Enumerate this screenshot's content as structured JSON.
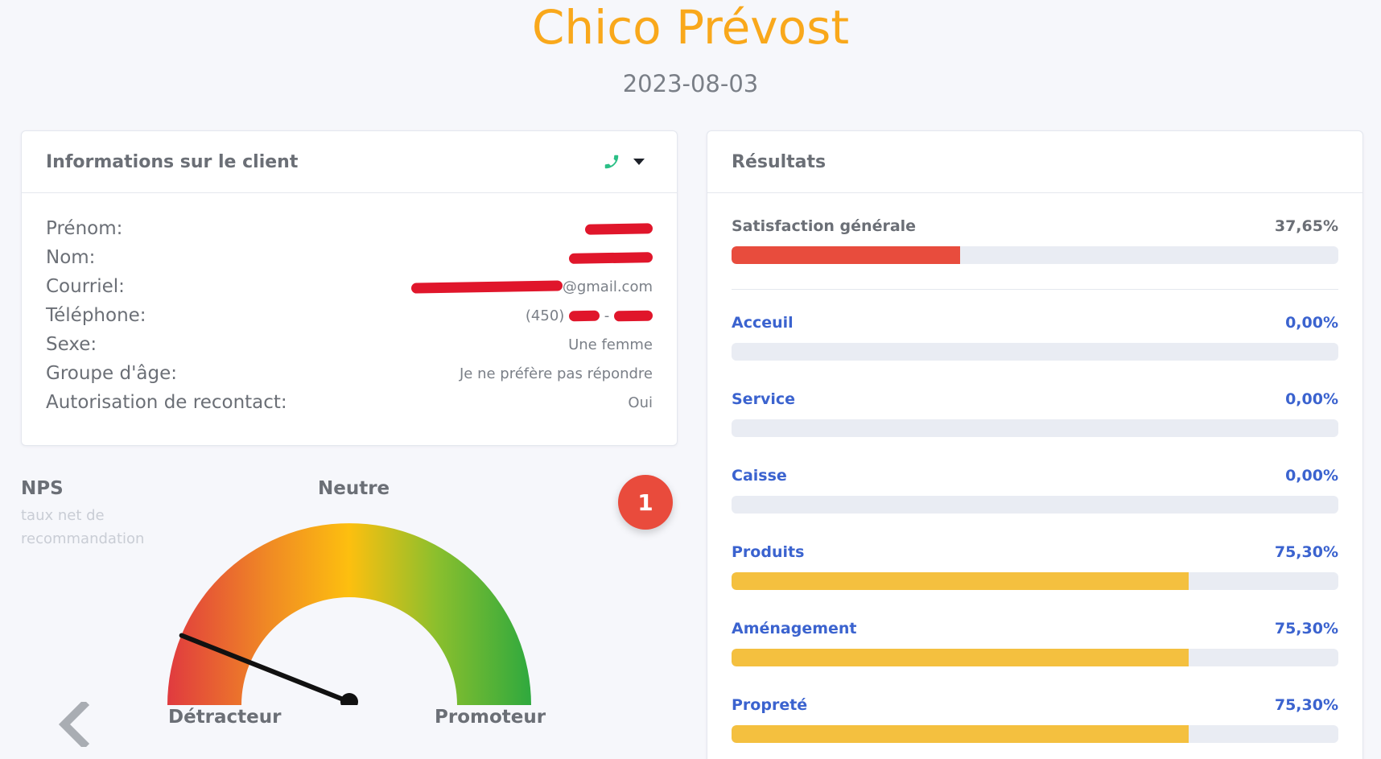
{
  "header": {
    "title": "Chico Prévost",
    "date": "2023-08-03"
  },
  "client_card": {
    "title": "Informations sur le client",
    "phone_icon": "phone-icon",
    "rows": [
      {
        "label": "Prénom:",
        "value": ""
      },
      {
        "label": "Nom:",
        "value": ""
      },
      {
        "label": "Courriel:",
        "value": "@gmail.com"
      },
      {
        "label": "Téléphone:",
        "value_prefix": "(450)",
        "value_sep": "-"
      },
      {
        "label": "Sexe:",
        "value": "Une femme"
      },
      {
        "label": "Groupe d'âge:",
        "value": "Je ne préfère pas répondre"
      },
      {
        "label": "Autorisation de recontact:",
        "value": "Oui"
      }
    ]
  },
  "nps": {
    "title": "NPS",
    "subtitle": "taux net de recommandation",
    "badge": "1",
    "label_left": "Détracteur",
    "label_center": "Neutre",
    "label_right": "Promoteur",
    "needle_fraction": 0.12,
    "colors": [
      "#e03a3f",
      "#f08a24",
      "#fdbf0f",
      "#8bbf2d",
      "#2fa93e"
    ]
  },
  "results": {
    "title": "Résultats",
    "overall": {
      "label": "Satisfaction générale",
      "value": "37,65%",
      "fraction": 0.3765,
      "color": "#e84c3d"
    },
    "items": [
      {
        "label": "Acceuil",
        "value": "0,00%",
        "fraction": 0.0,
        "color": "#f4c03f"
      },
      {
        "label": "Service",
        "value": "0,00%",
        "fraction": 0.0,
        "color": "#f4c03f"
      },
      {
        "label": "Caisse",
        "value": "0,00%",
        "fraction": 0.0,
        "color": "#f4c03f"
      },
      {
        "label": "Produits",
        "value": "75,30%",
        "fraction": 0.753,
        "color": "#f4c03f"
      },
      {
        "label": "Aménagement",
        "value": "75,30%",
        "fraction": 0.753,
        "color": "#f4c03f"
      },
      {
        "label": "Propreté",
        "value": "75,30%",
        "fraction": 0.753,
        "color": "#f4c03f"
      }
    ]
  }
}
